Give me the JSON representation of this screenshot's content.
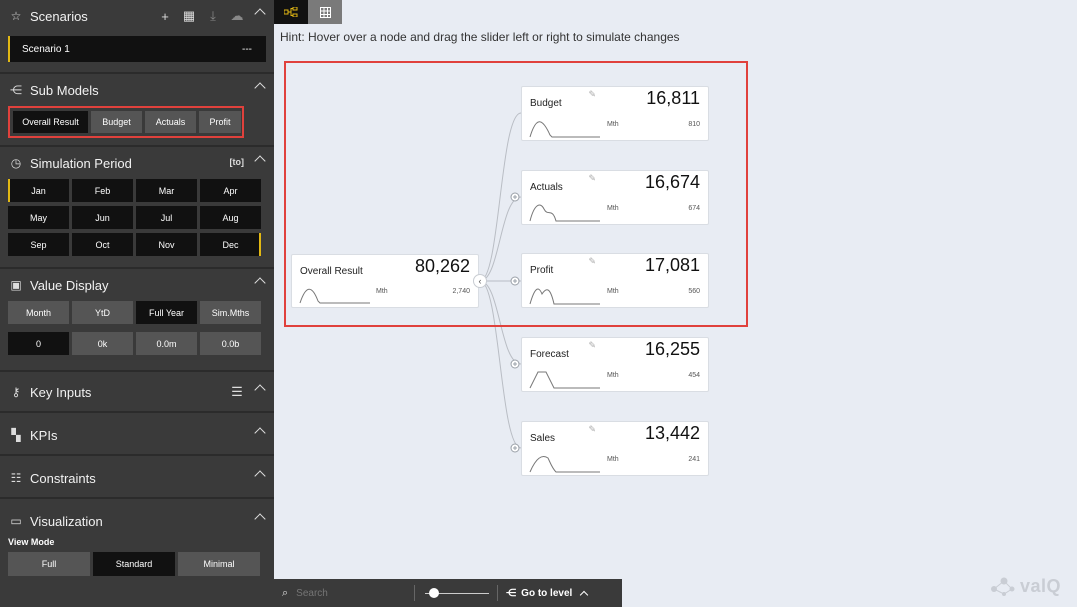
{
  "scenarios": {
    "title": "Scenarios",
    "items": [
      {
        "name": "Scenario 1",
        "menu": "---"
      }
    ]
  },
  "sub_models": {
    "title": "Sub Models",
    "buttons": [
      "Overall Result",
      "Budget",
      "Actuals",
      "Profit"
    ],
    "selected": "Overall Result"
  },
  "simulation_period": {
    "title": "Simulation Period",
    "badge": "[to]",
    "months": [
      "Jan",
      "Feb",
      "Mar",
      "Apr",
      "May",
      "Jun",
      "Jul",
      "Aug",
      "Sep",
      "Oct",
      "Nov",
      "Dec"
    ]
  },
  "value_display": {
    "title": "Value Display",
    "modes": [
      "Month",
      "YtD",
      "Full Year",
      "Sim.Mths"
    ],
    "selected_mode": "Full Year",
    "formats": [
      "0",
      "0k",
      "0.0m",
      "0.0b"
    ],
    "selected_format": "0"
  },
  "key_inputs": {
    "title": "Key Inputs"
  },
  "kpis": {
    "title": "KPIs"
  },
  "constraints": {
    "title": "Constraints"
  },
  "visualization": {
    "title": "Visualization",
    "view_mode_label": "View Mode",
    "modes": [
      "Full",
      "Standard",
      "Minimal"
    ],
    "selected": "Standard"
  },
  "hint": "Hint: Hover over a node and drag the slider left or right to simulate changes",
  "nodes": {
    "root": {
      "label": "Overall Result",
      "value": "80,262",
      "period": "Mth",
      "sub": "2,740"
    },
    "budget": {
      "label": "Budget",
      "value": "16,811",
      "period": "Mth",
      "sub": "810"
    },
    "actuals": {
      "label": "Actuals",
      "value": "16,674",
      "period": "Mth",
      "sub": "674"
    },
    "profit": {
      "label": "Profit",
      "value": "17,081",
      "period": "Mth",
      "sub": "560"
    },
    "forecast": {
      "label": "Forecast",
      "value": "16,255",
      "period": "Mth",
      "sub": "454"
    },
    "sales": {
      "label": "Sales",
      "value": "13,442",
      "period": "Mth",
      "sub": "241"
    }
  },
  "bottom_bar": {
    "search_placeholder": "Search",
    "goto_label": "Go to level"
  },
  "logo": "valQ",
  "colors": {
    "accent": "#e2b813",
    "highlight": "#e0413c",
    "sidebar": "#3a3a3a",
    "canvas": "#e8ecf3"
  }
}
